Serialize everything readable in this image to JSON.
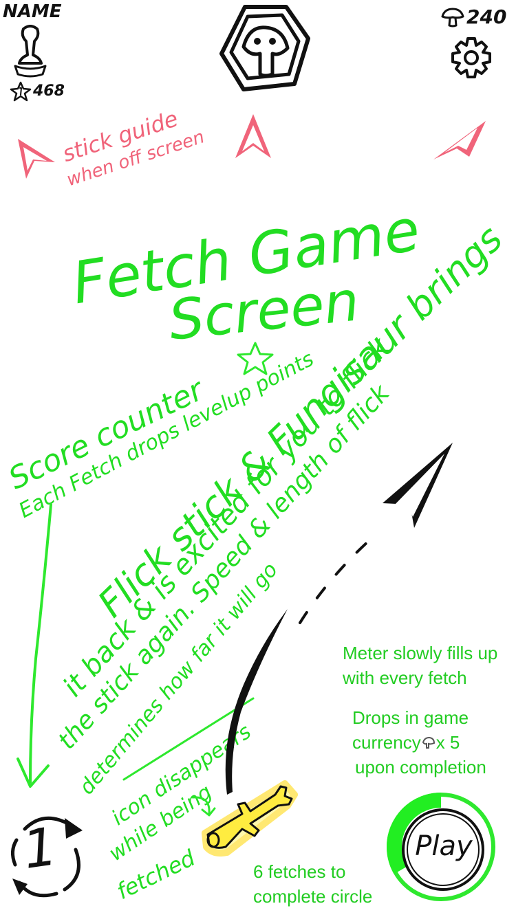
{
  "header": {
    "player_name": "NAME",
    "star_count": "468",
    "mushroom_currency": "240",
    "icons": [
      "trophy-icon",
      "star-icon",
      "mushroom-logo-icon",
      "mushroom-icon",
      "gear-icon"
    ]
  },
  "guide_note": {
    "line1": "stick guide",
    "line2": "when off screen"
  },
  "title": {
    "line1": "Fetch Game",
    "line2": "Screen"
  },
  "score_note": {
    "line1": "Score counter",
    "line2": "Each Fetch drops levelup points"
  },
  "flick_note": {
    "line1": "Flick stick & Fungisaur brings",
    "line2": "it back & is excited for you to flick",
    "line3": "the stick again. Speed & length of flick",
    "line4": "determines how far it will go"
  },
  "icon_note": {
    "line1": "icon disappears",
    "line2": "while being",
    "line3": "fetched"
  },
  "meter_note": {
    "line1": "Meter slowly fills up",
    "line2": "with every  fetch"
  },
  "currency_note": {
    "line1": "Drops in game",
    "line2_prefix": "currency",
    "line2_suffix": "x 5",
    "line3": "upon completion"
  },
  "circle_note": {
    "line1": "6 fetches to",
    "line2": "complete circle"
  },
  "score_counter": "1",
  "play_button": "Play",
  "meter": {
    "fetches_to_complete": 6,
    "filled": 2
  },
  "colors": {
    "annotation": "#22dd22",
    "guide_arrow": "#f0647a",
    "ink": "#111111",
    "stick_glow": "#ffd700"
  }
}
